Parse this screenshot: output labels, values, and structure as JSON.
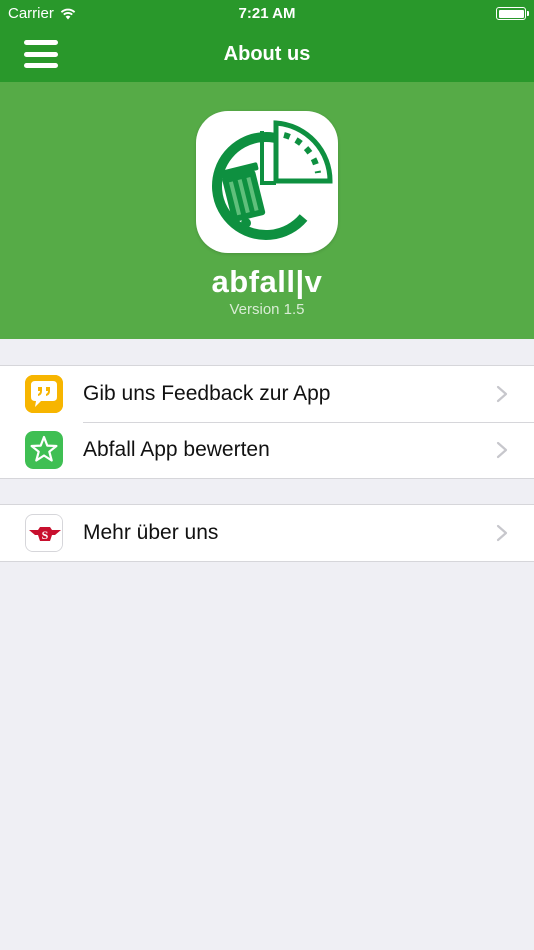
{
  "status": {
    "carrier": "Carrier",
    "time": "7:21 AM"
  },
  "nav": {
    "title": "About us"
  },
  "header": {
    "app_name": "abfall|v",
    "version": "Version 1.5"
  },
  "groups": [
    {
      "rows": [
        {
          "label": "Gib uns Feedback zur App",
          "icon": "feedback-icon"
        },
        {
          "label": "Abfall App bewerten",
          "icon": "star-icon"
        }
      ]
    },
    {
      "rows": [
        {
          "label": "Mehr über uns",
          "icon": "company-logo-icon"
        }
      ]
    }
  ],
  "colors": {
    "status_nav_bg": "#29982b",
    "banner_bg": "#56ab47",
    "page_bg": "#efeff4",
    "brand_green": "#0e9040"
  }
}
